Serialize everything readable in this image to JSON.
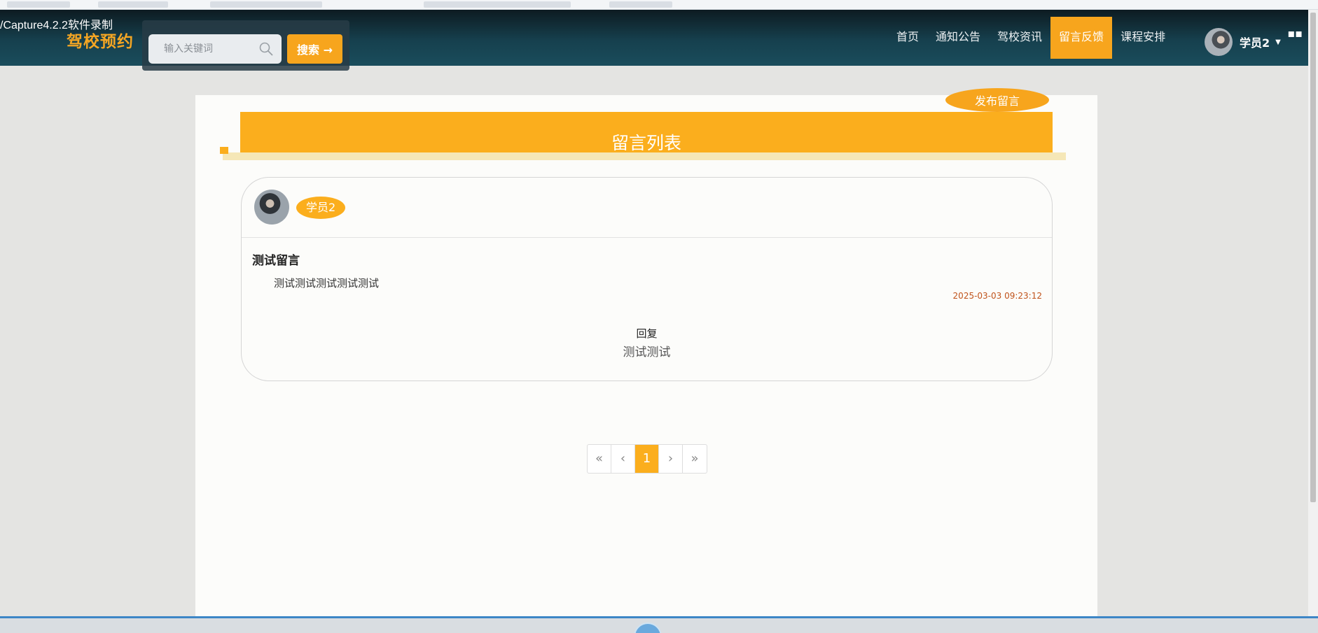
{
  "overlay": {
    "capture_label": "/Capture4.2.2软件录制"
  },
  "header": {
    "brand": "驾校预约",
    "search": {
      "placeholder": "输入关键词",
      "button_label": "搜索 →"
    },
    "nav": [
      {
        "label": "首页",
        "active": false
      },
      {
        "label": "通知公告",
        "active": false
      },
      {
        "label": "驾校资讯",
        "active": false
      },
      {
        "label": "留言反馈",
        "active": true
      },
      {
        "label": "课程安排",
        "active": false
      }
    ],
    "user": {
      "name": "学员2"
    }
  },
  "main": {
    "publish_button": "发布留言",
    "list_title": "留言列表",
    "messages": [
      {
        "author": "学员2",
        "title": "测试留言",
        "content": "测试测试测试测试测试",
        "time": "2025-03-03 09:23:12",
        "reply_label": "回复",
        "reply_text": "测试测试"
      }
    ],
    "pagination": {
      "first": "«",
      "prev": "‹",
      "current": "1",
      "next": "›",
      "last": "»"
    }
  },
  "colors": {
    "accent": "#fbae1d",
    "header_dark": "#16404e",
    "time_text": "#c0531b"
  }
}
